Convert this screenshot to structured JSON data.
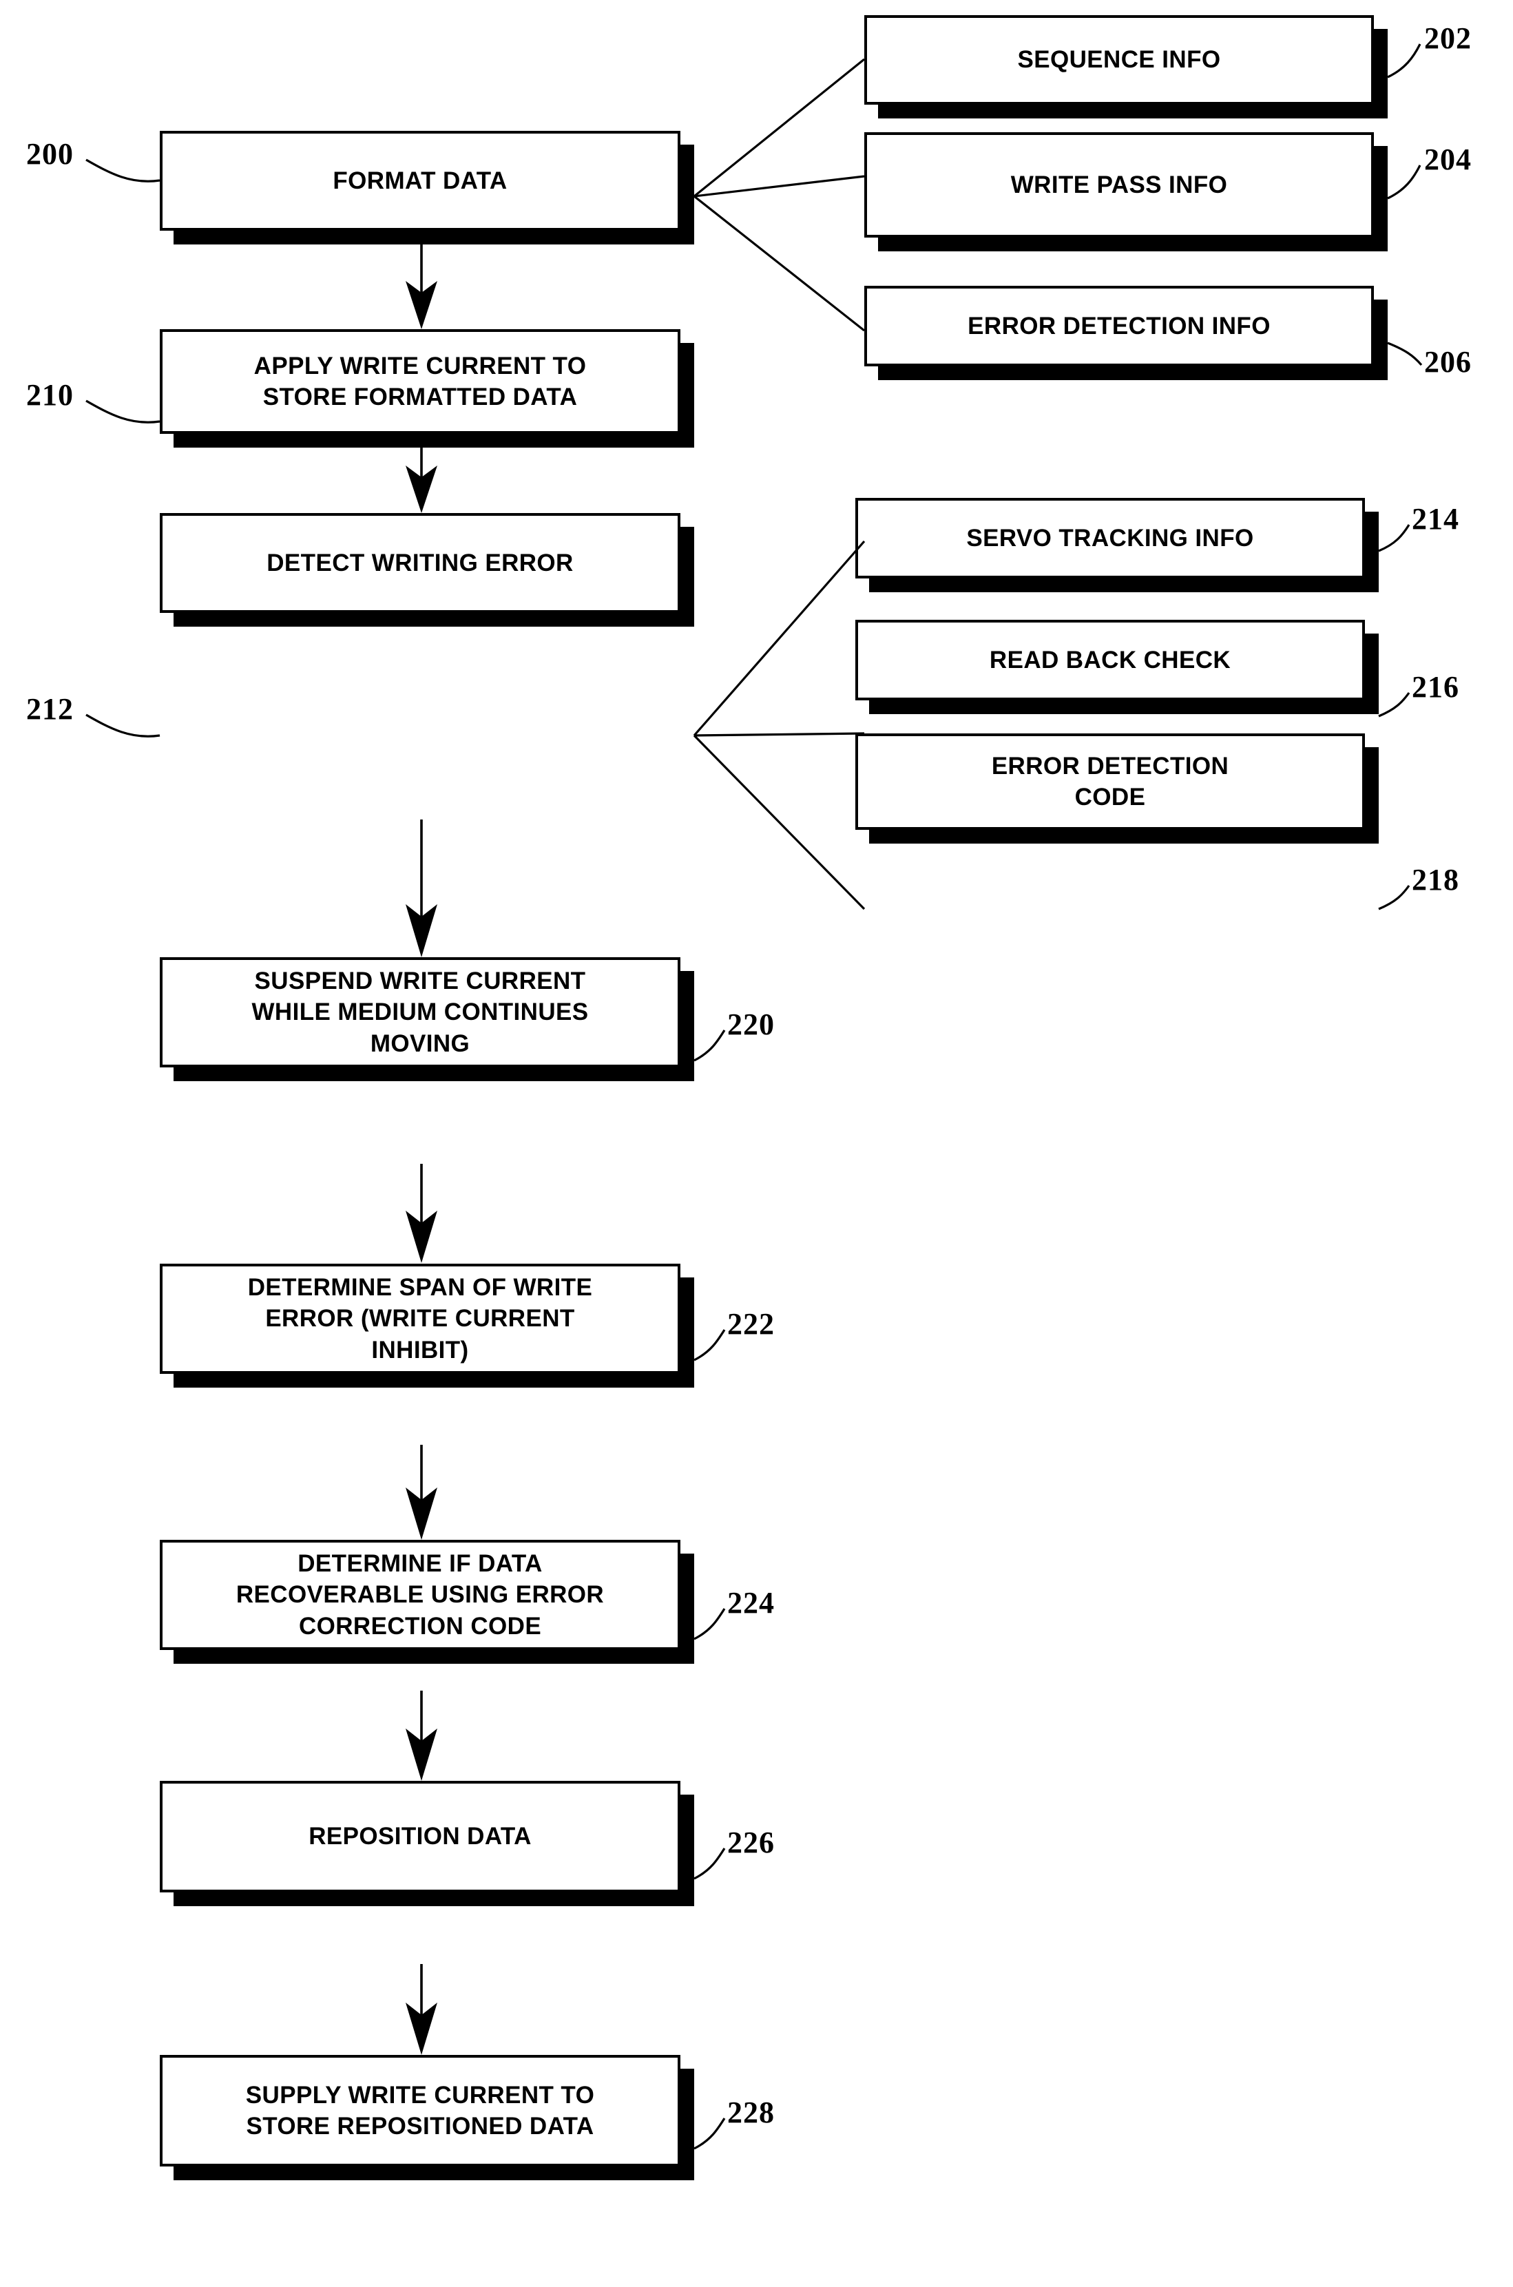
{
  "figure": {
    "type": "patent-flowchart",
    "orientation": "vertical-main-column-with-right-annex-groups"
  },
  "nodes": {
    "format_data": {
      "label": "FORMAT DATA",
      "ref": "200"
    },
    "sequence_info": {
      "label": "SEQUENCE INFO",
      "ref": "202"
    },
    "write_pass_info": {
      "label": "WRITE PASS INFO",
      "ref": "204"
    },
    "error_detection_info": {
      "label": "ERROR DETECTION INFO",
      "ref": "206"
    },
    "apply_write_current": {
      "label": "APPLY WRITE CURRENT TO\nSTORE FORMATTED DATA",
      "ref": "210"
    },
    "detect_writing_error": {
      "label": "DETECT WRITING ERROR",
      "ref": "212"
    },
    "servo_tracking_info": {
      "label": "SERVO TRACKING INFO",
      "ref": "214"
    },
    "read_back_check": {
      "label": "READ BACK CHECK",
      "ref": "216"
    },
    "error_detection_code": {
      "label": "ERROR DETECTION\nCODE",
      "ref": "218"
    },
    "suspend_write_current": {
      "label": "SUSPEND WRITE CURRENT\nWHILE MEDIUM CONTINUES\nMOVING",
      "ref": "220"
    },
    "determine_span": {
      "label": "DETERMINE SPAN OF WRITE\nERROR (WRITE CURRENT\nINHIBIT)",
      "ref": "222"
    },
    "determine_recoverable": {
      "label": "DETERMINE IF DATA\nRECOVERABLE USING ERROR\nCORRECTION CODE",
      "ref": "224"
    },
    "reposition_data": {
      "label": "REPOSITION DATA",
      "ref": "226"
    },
    "supply_write_current": {
      "label": "SUPPLY WRITE CURRENT TO\nSTORE REPOSITIONED DATA",
      "ref": "228"
    }
  },
  "colors": {
    "ink": "#000000",
    "paper": "#ffffff"
  }
}
